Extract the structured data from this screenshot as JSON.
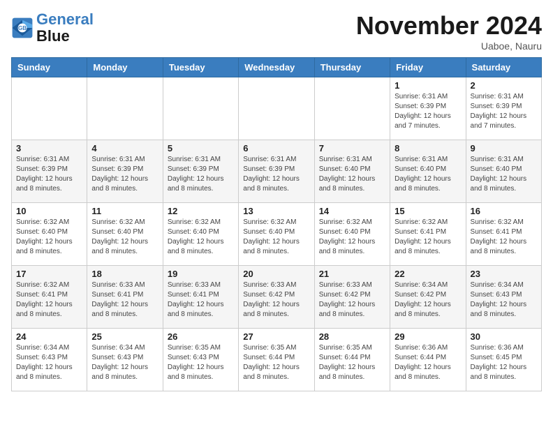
{
  "header": {
    "logo_line1": "General",
    "logo_line2": "Blue",
    "month": "November 2024",
    "location": "Uaboe, Nauru"
  },
  "weekdays": [
    "Sunday",
    "Monday",
    "Tuesday",
    "Wednesday",
    "Thursday",
    "Friday",
    "Saturday"
  ],
  "weeks": [
    [
      {
        "day": "",
        "info": ""
      },
      {
        "day": "",
        "info": ""
      },
      {
        "day": "",
        "info": ""
      },
      {
        "day": "",
        "info": ""
      },
      {
        "day": "",
        "info": ""
      },
      {
        "day": "1",
        "info": "Sunrise: 6:31 AM\nSunset: 6:39 PM\nDaylight: 12 hours\nand 7 minutes."
      },
      {
        "day": "2",
        "info": "Sunrise: 6:31 AM\nSunset: 6:39 PM\nDaylight: 12 hours\nand 7 minutes."
      }
    ],
    [
      {
        "day": "3",
        "info": "Sunrise: 6:31 AM\nSunset: 6:39 PM\nDaylight: 12 hours\nand 8 minutes."
      },
      {
        "day": "4",
        "info": "Sunrise: 6:31 AM\nSunset: 6:39 PM\nDaylight: 12 hours\nand 8 minutes."
      },
      {
        "day": "5",
        "info": "Sunrise: 6:31 AM\nSunset: 6:39 PM\nDaylight: 12 hours\nand 8 minutes."
      },
      {
        "day": "6",
        "info": "Sunrise: 6:31 AM\nSunset: 6:39 PM\nDaylight: 12 hours\nand 8 minutes."
      },
      {
        "day": "7",
        "info": "Sunrise: 6:31 AM\nSunset: 6:40 PM\nDaylight: 12 hours\nand 8 minutes."
      },
      {
        "day": "8",
        "info": "Sunrise: 6:31 AM\nSunset: 6:40 PM\nDaylight: 12 hours\nand 8 minutes."
      },
      {
        "day": "9",
        "info": "Sunrise: 6:31 AM\nSunset: 6:40 PM\nDaylight: 12 hours\nand 8 minutes."
      }
    ],
    [
      {
        "day": "10",
        "info": "Sunrise: 6:32 AM\nSunset: 6:40 PM\nDaylight: 12 hours\nand 8 minutes."
      },
      {
        "day": "11",
        "info": "Sunrise: 6:32 AM\nSunset: 6:40 PM\nDaylight: 12 hours\nand 8 minutes."
      },
      {
        "day": "12",
        "info": "Sunrise: 6:32 AM\nSunset: 6:40 PM\nDaylight: 12 hours\nand 8 minutes."
      },
      {
        "day": "13",
        "info": "Sunrise: 6:32 AM\nSunset: 6:40 PM\nDaylight: 12 hours\nand 8 minutes."
      },
      {
        "day": "14",
        "info": "Sunrise: 6:32 AM\nSunset: 6:40 PM\nDaylight: 12 hours\nand 8 minutes."
      },
      {
        "day": "15",
        "info": "Sunrise: 6:32 AM\nSunset: 6:41 PM\nDaylight: 12 hours\nand 8 minutes."
      },
      {
        "day": "16",
        "info": "Sunrise: 6:32 AM\nSunset: 6:41 PM\nDaylight: 12 hours\nand 8 minutes."
      }
    ],
    [
      {
        "day": "17",
        "info": "Sunrise: 6:32 AM\nSunset: 6:41 PM\nDaylight: 12 hours\nand 8 minutes."
      },
      {
        "day": "18",
        "info": "Sunrise: 6:33 AM\nSunset: 6:41 PM\nDaylight: 12 hours\nand 8 minutes."
      },
      {
        "day": "19",
        "info": "Sunrise: 6:33 AM\nSunset: 6:41 PM\nDaylight: 12 hours\nand 8 minutes."
      },
      {
        "day": "20",
        "info": "Sunrise: 6:33 AM\nSunset: 6:42 PM\nDaylight: 12 hours\nand 8 minutes."
      },
      {
        "day": "21",
        "info": "Sunrise: 6:33 AM\nSunset: 6:42 PM\nDaylight: 12 hours\nand 8 minutes."
      },
      {
        "day": "22",
        "info": "Sunrise: 6:34 AM\nSunset: 6:42 PM\nDaylight: 12 hours\nand 8 minutes."
      },
      {
        "day": "23",
        "info": "Sunrise: 6:34 AM\nSunset: 6:43 PM\nDaylight: 12 hours\nand 8 minutes."
      }
    ],
    [
      {
        "day": "24",
        "info": "Sunrise: 6:34 AM\nSunset: 6:43 PM\nDaylight: 12 hours\nand 8 minutes."
      },
      {
        "day": "25",
        "info": "Sunrise: 6:34 AM\nSunset: 6:43 PM\nDaylight: 12 hours\nand 8 minutes."
      },
      {
        "day": "26",
        "info": "Sunrise: 6:35 AM\nSunset: 6:43 PM\nDaylight: 12 hours\nand 8 minutes."
      },
      {
        "day": "27",
        "info": "Sunrise: 6:35 AM\nSunset: 6:44 PM\nDaylight: 12 hours\nand 8 minutes."
      },
      {
        "day": "28",
        "info": "Sunrise: 6:35 AM\nSunset: 6:44 PM\nDaylight: 12 hours\nand 8 minutes."
      },
      {
        "day": "29",
        "info": "Sunrise: 6:36 AM\nSunset: 6:44 PM\nDaylight: 12 hours\nand 8 minutes."
      },
      {
        "day": "30",
        "info": "Sunrise: 6:36 AM\nSunset: 6:45 PM\nDaylight: 12 hours\nand 8 minutes."
      }
    ]
  ]
}
